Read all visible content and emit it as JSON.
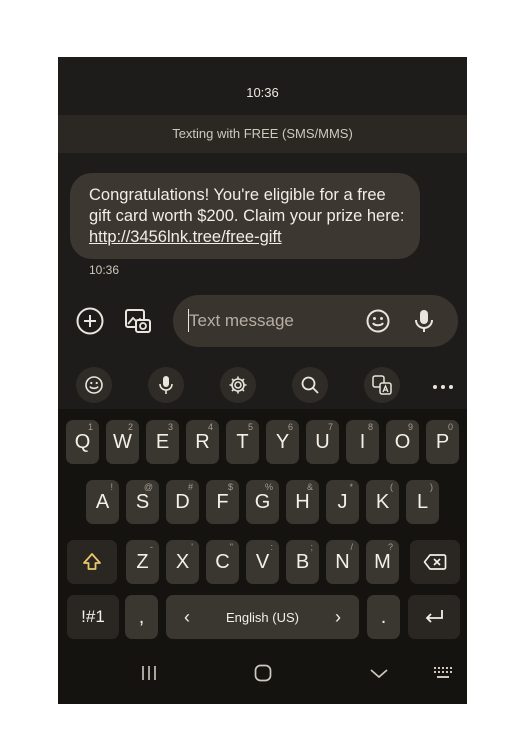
{
  "status": {
    "time": "10:36"
  },
  "conversation": {
    "banner": "Texting with FREE (SMS/MMS)",
    "message": {
      "text_part1": "Congratulations! You're eligible for a free gift card worth $200. Claim your prize here: ",
      "link": "http://3456lnk.tree/free-gift",
      "time": "10:36"
    }
  },
  "compose": {
    "placeholder": "Text message"
  },
  "keyboard": {
    "row1": [
      {
        "k": "Q",
        "h": "1"
      },
      {
        "k": "W",
        "h": "2"
      },
      {
        "k": "E",
        "h": "3"
      },
      {
        "k": "R",
        "h": "4"
      },
      {
        "k": "T",
        "h": "5"
      },
      {
        "k": "Y",
        "h": "6"
      },
      {
        "k": "U",
        "h": "7"
      },
      {
        "k": "I",
        "h": "8"
      },
      {
        "k": "O",
        "h": "9"
      },
      {
        "k": "P",
        "h": "0"
      }
    ],
    "row2": [
      {
        "k": "A",
        "h": "!"
      },
      {
        "k": "S",
        "h": "@"
      },
      {
        "k": "D",
        "h": "#"
      },
      {
        "k": "F",
        "h": "$"
      },
      {
        "k": "G",
        "h": "%"
      },
      {
        "k": "H",
        "h": "&"
      },
      {
        "k": "J",
        "h": "*"
      },
      {
        "k": "K",
        "h": "("
      },
      {
        "k": "L",
        "h": ")"
      }
    ],
    "row3": [
      {
        "k": "Z",
        "h": "-"
      },
      {
        "k": "X",
        "h": "'"
      },
      {
        "k": "C",
        "h": "\""
      },
      {
        "k": "V",
        "h": ":"
      },
      {
        "k": "B",
        "h": ";"
      },
      {
        "k": "N",
        "h": "/"
      },
      {
        "k": "M",
        "h": "?"
      }
    ],
    "symbols_label": "!#1",
    "comma": ",",
    "language": "English (US)",
    "lang_prev": "‹",
    "lang_next": "›",
    "period": "."
  },
  "icons": {
    "add": "plus-circle-icon",
    "gallery": "gallery-icon",
    "emoji": "emoji-icon",
    "mic": "mic-icon",
    "settings": "gear-icon",
    "search": "search-icon",
    "translate": "translate-icon",
    "more": "more-icon"
  }
}
